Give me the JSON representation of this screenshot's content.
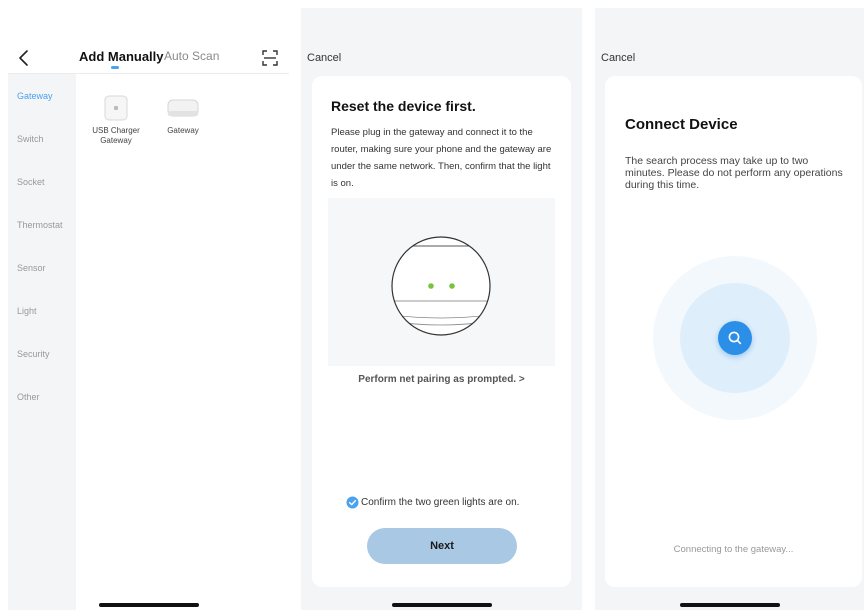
{
  "add_device": {
    "tabs": {
      "manual": "Add Manually",
      "auto": "Auto Scan"
    },
    "categories": [
      "Gateway",
      "Switch",
      "Socket",
      "Thermostat",
      "Sensor",
      "Light",
      "Security",
      "Other"
    ],
    "active_category": "Gateway",
    "devices": [
      {
        "line1": "USB Charger",
        "line2": "Gateway"
      },
      {
        "line1": "Gateway",
        "line2": ""
      }
    ]
  },
  "reset": {
    "cancel": "Cancel",
    "title": "Reset the device first.",
    "description": "Please plug in the gateway and connect it to the router, making sure your phone and the gateway are under the same network. Then, confirm that the light is on.",
    "pairing_link": "Perform net pairing as prompted. >",
    "confirm_label": "Confirm the two green lights are on.",
    "confirm_checked": true,
    "next_button": "Next"
  },
  "connect": {
    "cancel": "Cancel",
    "title": "Connect Device",
    "description": "The search process may take up to two minutes. Please do not perform any operations during this time.",
    "status": "Connecting to the gateway..."
  },
  "colors": {
    "accent": "#4aa3ee",
    "primary_button": "#a9c8e4",
    "search_button": "#2b8fe8",
    "indicator_lights": "#7cc242"
  }
}
